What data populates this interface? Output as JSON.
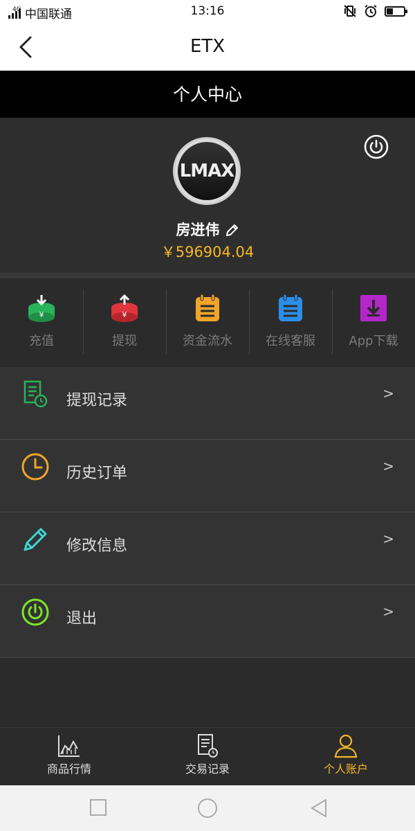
{
  "status_bar": {
    "network": "4G",
    "carrier": "中国联通",
    "time": "13:16"
  },
  "header": {
    "title": "ETX"
  },
  "section_title": "个人中心",
  "profile": {
    "avatar_text": "LMAX",
    "name": "房进伟",
    "balance": "￥596904.04"
  },
  "quick_actions": [
    {
      "label": "充值",
      "icon": "recharge-icon",
      "color": "#29b35a"
    },
    {
      "label": "提现",
      "icon": "withdraw-icon",
      "color": "#e0353c"
    },
    {
      "label": "资金流水",
      "icon": "funds-flow-icon",
      "color": "#f0a52a"
    },
    {
      "label": "在线客服",
      "icon": "customer-service-icon",
      "color": "#2b8ee8"
    },
    {
      "label": "App下载",
      "icon": "download-icon",
      "color": "#b327c9"
    }
  ],
  "menu": [
    {
      "label": "提现记录",
      "icon": "withdraw-record-icon",
      "color": "#29b35a",
      "arrow": ">"
    },
    {
      "label": "历史订单",
      "icon": "clock-icon",
      "color": "#f0a52a",
      "arrow": ">"
    },
    {
      "label": "修改信息",
      "icon": "pencil-icon",
      "color": "#3fd6d6",
      "arrow": ">"
    },
    {
      "label": "退出",
      "icon": "power-icon",
      "color": "#7de52a",
      "arrow": ">"
    }
  ],
  "tabs": [
    {
      "label": "商品行情",
      "icon": "chart-icon",
      "active": false
    },
    {
      "label": "交易记录",
      "icon": "document-icon",
      "active": false
    },
    {
      "label": "个人账户",
      "icon": "user-icon",
      "active": true
    }
  ],
  "accent_color": "#f4b825"
}
